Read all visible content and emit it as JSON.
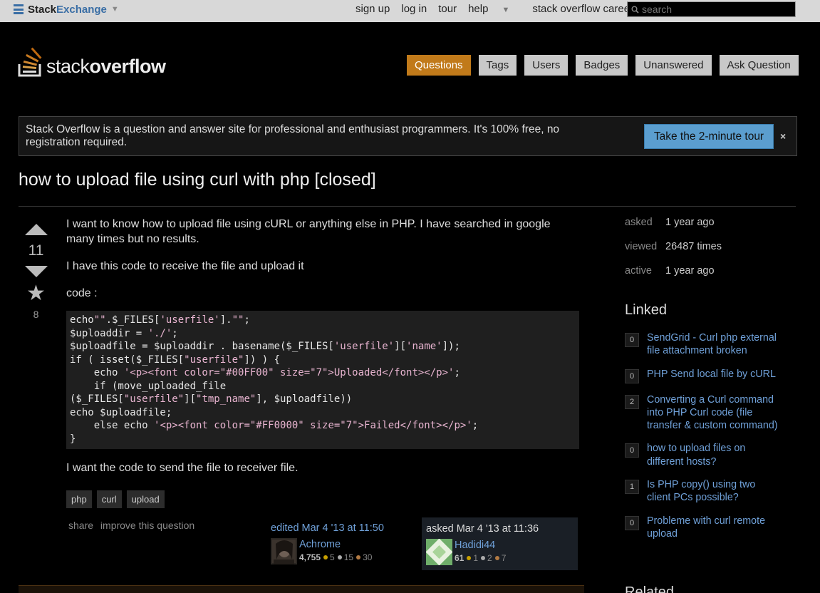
{
  "topbar": {
    "brand_part1": "Stack",
    "brand_part2": "Exchange",
    "links": [
      "sign up",
      "log in",
      "tour",
      "help",
      "stack overflow careers"
    ],
    "search_placeholder": "search"
  },
  "header": {
    "logo_plain": "stack",
    "logo_bold": "overflow",
    "nav": [
      "Questions",
      "Tags",
      "Users",
      "Badges",
      "Unanswered",
      "Ask Question"
    ],
    "active_nav": "Questions"
  },
  "notice": {
    "text": "Stack Overflow is a question and answer site for professional and enthusiast programmers. It's 100% free, no registration required.",
    "button": "Take the 2-minute tour",
    "close": "×"
  },
  "question": {
    "title": "how to upload file using curl with php [closed]",
    "votes": "11",
    "favorites": "8",
    "para1": "I want to know how to upload file using cURL or anything else in PHP. I have searched in google many times but no results.",
    "para2": "I have this code to receive the file and upload it",
    "para3": "code :",
    "para4": "I want the code to send the file to receiver file.",
    "code_lines": [
      "echo\"\".$_FILES['userfile'].\"\";",
      "$uploaddir = './';",
      "$uploadfile = $uploaddir . basename($_FILES['userfile']['name']);",
      "if ( isset($_FILES[\"userfile\"]) ) {",
      "    echo '<p><font color=\"#00FF00\" size=\"7\">Uploaded</font></p>';",
      "    if (move_uploaded_file",
      "($_FILES[\"userfile\"][\"tmp_name\"], $uploadfile))",
      "echo $uploadfile;",
      "    else echo '<p><font color=\"#FF0000\" size=\"7\">Failed</font></p>';",
      "}"
    ],
    "tags": [
      "php",
      "curl",
      "upload"
    ],
    "menu": {
      "share": "share",
      "improve": "improve this question"
    },
    "editor": {
      "action": "edited Mar 4 '13 at 11:50",
      "name": "Achrome",
      "rep": "4,755",
      "gold": "5",
      "silver": "15",
      "bronze": "30"
    },
    "owner": {
      "action": "asked Mar 4 '13 at 11:36",
      "name": "Hadidi44",
      "rep": "61",
      "gold": "1",
      "silver": "2",
      "bronze": "7"
    }
  },
  "sidebar": {
    "stats": [
      {
        "label": "asked",
        "value": "1 year ago"
      },
      {
        "label": "viewed",
        "value": "26487 times"
      },
      {
        "label": "active",
        "value": "1 year ago"
      }
    ],
    "linked_title": "Linked",
    "linked": [
      {
        "count": "0",
        "title": "SendGrid - Curl php external file attachment broken"
      },
      {
        "count": "0",
        "title": "PHP Send local file by cURL"
      },
      {
        "count": "2",
        "title": "Converting a Curl command into PHP Curl code (file transfer & custom command)"
      },
      {
        "count": "0",
        "title": "how to upload files on different hosts?"
      },
      {
        "count": "1",
        "title": "Is PHP copy() using two client PCs possible?"
      },
      {
        "count": "0",
        "title": "Probleme with curl remote upload"
      }
    ],
    "related_title": "Related"
  },
  "colors": {
    "accent": "#c17a1a",
    "link": "#6fa0d8",
    "tour_button": "#5b9ecf",
    "gold": "#c8a000",
    "silver": "#aaaaaa",
    "bronze": "#b27a43"
  }
}
